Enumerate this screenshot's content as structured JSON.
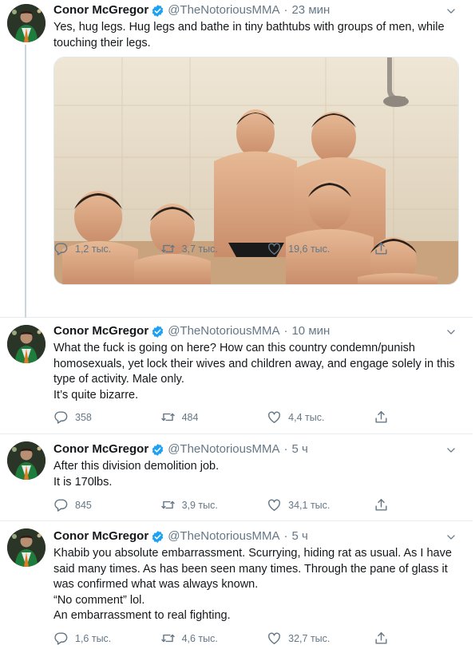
{
  "tweets": [
    {
      "name": "Conor McGregor",
      "handle": "@TheNotoriousMMA",
      "time": "23 мин",
      "lines": [
        "Yes, hug legs. Hug legs and bathe in tiny bathtubs with groups of men, while touching their legs."
      ],
      "replies": "1,2 тыс.",
      "retweets": "3,7 тыс.",
      "likes": "19,6 тыс."
    },
    {
      "name": "Conor McGregor",
      "handle": "@TheNotoriousMMA",
      "time": "10 мин",
      "lines": [
        "What the fuck is going on here? How can this country condemn/punish homosexuals, yet lock their wives and children away, and engage solely in this type of activity. Male only.",
        "It’s quite bizarre."
      ],
      "replies": "358",
      "retweets": "484",
      "likes": "4,4 тыс."
    },
    {
      "name": "Conor McGregor",
      "handle": "@TheNotoriousMMA",
      "time": "5 ч",
      "lines": [
        "After this division demolition job.",
        "It is 170lbs."
      ],
      "replies": "845",
      "retweets": "3,9 тыс.",
      "likes": "34,1 тыс."
    },
    {
      "name": "Conor McGregor",
      "handle": "@TheNotoriousMMA",
      "time": "5 ч",
      "lines": [
        "Khabib you absolute embarrassment. Scurrying, hiding rat as usual. As I have said many times. As has been seen many times. Through the pane of glass it was confirmed what was always known.",
        "“No comment” lol.",
        "An embarrassment to real fighting."
      ],
      "replies": "1,6 тыс.",
      "retweets": "4,6 тыс.",
      "likes": "32,7 тыс."
    }
  ],
  "colors": {
    "verified": "#1da1f2",
    "muted": "#657786",
    "divider": "#e6ecf0",
    "thread": "#ccd6dd"
  },
  "icons": [
    "reply-icon",
    "retweet-icon",
    "like-icon",
    "share-icon",
    "verified-badge-icon",
    "chevron-down-icon"
  ]
}
